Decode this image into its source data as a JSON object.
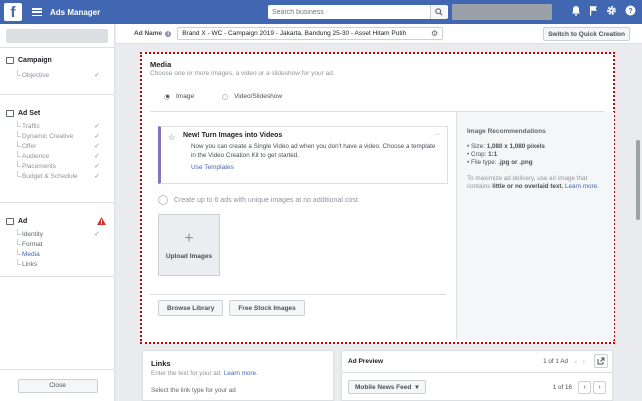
{
  "topbar": {
    "logo": "f",
    "title": "Ads Manager",
    "search_placeholder": "Search business",
    "icons": [
      "bell-icon",
      "flag-icon",
      "gear-icon",
      "help-icon"
    ]
  },
  "sidebar": {
    "campaign": {
      "title": "Campaign",
      "items": [
        {
          "label": "Objective",
          "done": true
        }
      ]
    },
    "adset": {
      "title": "Ad Set",
      "items": [
        {
          "label": "Traffic",
          "done": true
        },
        {
          "label": "Dynamic Creative",
          "done": true
        },
        {
          "label": "Offer",
          "done": true
        },
        {
          "label": "Audience",
          "done": true
        },
        {
          "label": "Placements",
          "done": true
        },
        {
          "label": "Budget & Schedule",
          "done": true
        }
      ]
    },
    "ad": {
      "title": "Ad",
      "items": [
        {
          "label": "Identity",
          "done": true
        },
        {
          "label": "Format"
        },
        {
          "label": "Media"
        },
        {
          "label": "Links"
        }
      ]
    },
    "close_label": "Close"
  },
  "adname": {
    "label": "Ad Name",
    "value": "Brand X - WC - Campaign 2019 - Jakarta, Bandung 25-30 - Asset Hitam Putih",
    "quick_creation": "Switch to Quick Creation"
  },
  "media": {
    "title": "Media",
    "subtitle": "Choose one or more images, a video or a slideshow for your ad.",
    "options": [
      "Image",
      "Video/Slideshow"
    ],
    "selected": "Image",
    "notice": {
      "title": "New! Turn Images into Videos",
      "body": "Now you can create a Single Video ad when you don't have a video. Choose a template in the Video Creation Kit to get started.",
      "link": "Use Templates",
      "more": "···"
    },
    "create_hint": "Create up to 6 ads with unique images at no additional cost.",
    "upload_label": "Upload Images",
    "browse_label": "Browse Library",
    "stock_label": "Free Stock Images",
    "recs": {
      "title": "Image Recommendations",
      "size_prefix": "• Size: ",
      "size": "1,080 x 1,080 pixels",
      "crop_prefix": "• Crop: ",
      "crop": "1:1",
      "type_prefix": "• File type: ",
      "type": ".jpg or .png",
      "note_pre": "To maximize ad delivery, use an image that contains ",
      "note_bold": "little or no overlaid text.",
      "note_link": "Learn more."
    }
  },
  "links": {
    "title": "Links",
    "subtitle_pre": "Enter the text for your ad. ",
    "subtitle_link": "Learn more.",
    "choose": "Select the link type for your ad"
  },
  "preview": {
    "title": "Ad Preview",
    "count": "1 of 1 Ad",
    "feed": "Mobile News Feed",
    "feed_count": "1 of 16"
  }
}
